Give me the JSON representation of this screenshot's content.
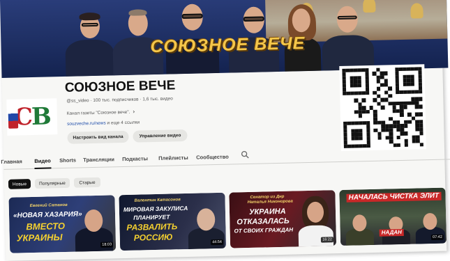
{
  "banner": {
    "title": "СОЮЗНОЕ ВЕЧЕ"
  },
  "channel": {
    "name": "СОЮЗНОЕ ВЕЧЕ",
    "meta": "@ss_video · 100 тыс. подписчиков · 1,6 тыс. видео",
    "description": "Канал газеты \"Союзное вече\".",
    "link_text": "souzveche.ru/news",
    "link_more": "и еще 4 ссылки",
    "avatar_text_1": "С",
    "avatar_text_2": "В",
    "customize_button": "Настроить вид канала",
    "manage_button": "Управление видео"
  },
  "tabs": [
    {
      "label": "Главная"
    },
    {
      "label": "Видео"
    },
    {
      "label": "Shorts"
    },
    {
      "label": "Трансляции"
    },
    {
      "label": "Подкасты"
    },
    {
      "label": "Плейлисты"
    },
    {
      "label": "Сообщество"
    }
  ],
  "chips": [
    {
      "label": "Новые"
    },
    {
      "label": "Популярные"
    },
    {
      "label": "Старые"
    }
  ],
  "videos": [
    {
      "subtitle": "Евгений Сатанов",
      "lines": [
        "«НОВАЯ ХАЗАРИЯ»",
        "ВМЕСТО",
        "УКРАИНЫ"
      ],
      "duration": "18:03"
    },
    {
      "subtitle": "Валентин Катасонов",
      "lines": [
        "МИРОВАЯ ЗАКУЛИСА",
        "ПЛАНИРУЕТ",
        "РАЗВАЛИТЬ",
        "РОССИЮ"
      ],
      "duration": "44:54"
    },
    {
      "subtitle_1": "Сенатор из Днр",
      "subtitle_2": "Наталья Никонорова",
      "lines": [
        "УКРАИНА",
        "ОТКАЗАЛАСЬ",
        "ОТ СВОИХ ГРАЖДАН"
      ],
      "duration": "16:22"
    },
    {
      "lines": [
        "НАЧАЛАСЬ ЧИСТКА ЭЛИТ",
        "НАДАН"
      ],
      "duration": "07:42"
    }
  ],
  "colors": {
    "banner_title": "#f4c64a",
    "banner_bg": "#1e2f63",
    "link": "#1b4aa8",
    "thumb_red": "#e02a2a",
    "thumb_yellow": "#f4d030"
  },
  "icons": {
    "search": "magnifier",
    "chevron": "chevron-right"
  }
}
